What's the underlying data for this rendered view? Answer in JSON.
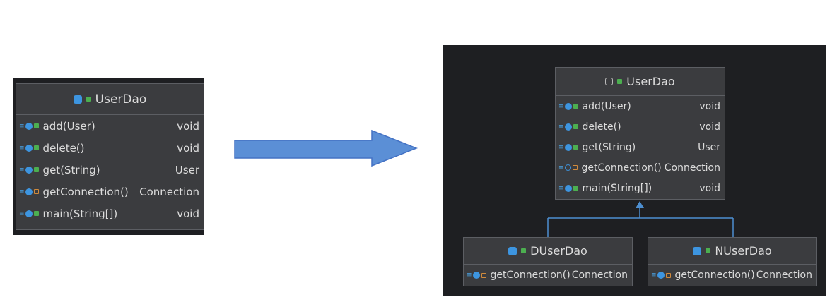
{
  "left_class": {
    "title": "UserDao",
    "methods": [
      {
        "name": "add(User)",
        "ret": "void",
        "vis": "public"
      },
      {
        "name": "delete()",
        "ret": "void",
        "vis": "public"
      },
      {
        "name": "get(String)",
        "ret": "User",
        "vis": "public"
      },
      {
        "name": "getConnection()",
        "ret": "Connection",
        "vis": "protected"
      },
      {
        "name": "main(String[])",
        "ret": "void",
        "vis": "public"
      }
    ]
  },
  "arrow": {
    "color": "#5b8fd6"
  },
  "right_diagram": {
    "parent": {
      "title": "UserDao",
      "methods": [
        {
          "name": "add(User)",
          "ret": "void",
          "vis": "public"
        },
        {
          "name": "delete()",
          "ret": "void",
          "vis": "public"
        },
        {
          "name": "get(String)",
          "ret": "User",
          "vis": "public"
        },
        {
          "name": "getConnection()",
          "ret": "Connection",
          "vis": "protected"
        },
        {
          "name": "main(String[])",
          "ret": "void",
          "vis": "public"
        }
      ]
    },
    "children": [
      {
        "title": "DUserDao",
        "methods": [
          {
            "name": "getConnection()",
            "ret": "Connection",
            "vis": "protected"
          }
        ]
      },
      {
        "title": "NUserDao",
        "methods": [
          {
            "name": "getConnection()",
            "ret": "Connection",
            "vis": "protected"
          }
        ]
      }
    ],
    "edge_color": "#4d8fd1"
  }
}
